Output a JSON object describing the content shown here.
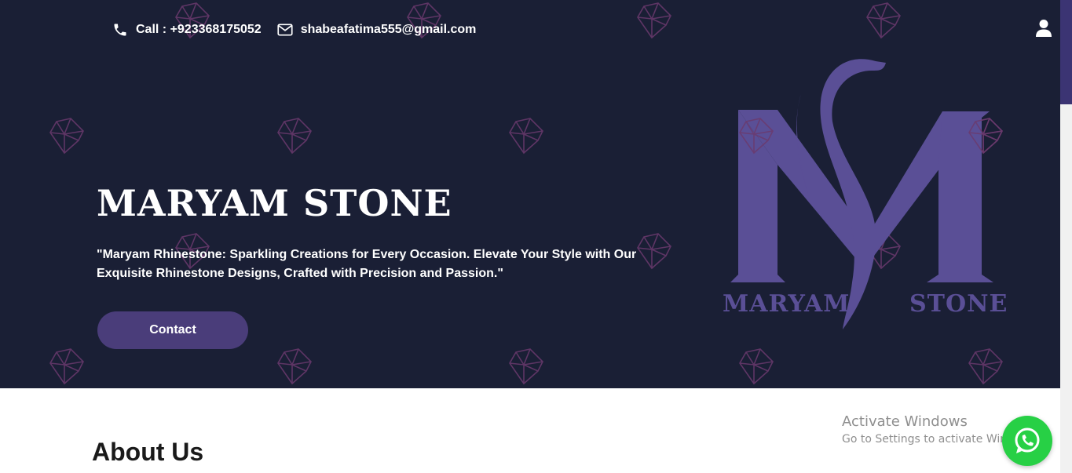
{
  "header": {
    "phone_label": "Call : +923368175052",
    "email_label": "shabeafatima555@gmail.com",
    "user_icon": "user-icon"
  },
  "hero": {
    "title": "MARYAM STONE",
    "tagline": "\"Maryam Rhinestone: Sparkling Creations for Every Occasion. Elevate Your Style with Our Exquisite Rhinestone Designs, Crafted with Precision and Passion.\"",
    "contact_button": "Contact",
    "background_color": "#1a1f35",
    "pattern_icon": "diamond-icon"
  },
  "logo": {
    "text_left": "MARYAM",
    "text_right": "STONE",
    "color": "#5a4f96"
  },
  "about": {
    "heading": "About Us"
  },
  "system": {
    "activation_title": "Activate Windows",
    "activation_subtitle": "Go to Settings to activate Windows."
  },
  "floating": {
    "whatsapp_icon": "whatsapp-icon",
    "whatsapp_color": "#27d045"
  },
  "colors": {
    "accent": "#4a3d7a",
    "scroll_thumb": "#3b3473"
  }
}
